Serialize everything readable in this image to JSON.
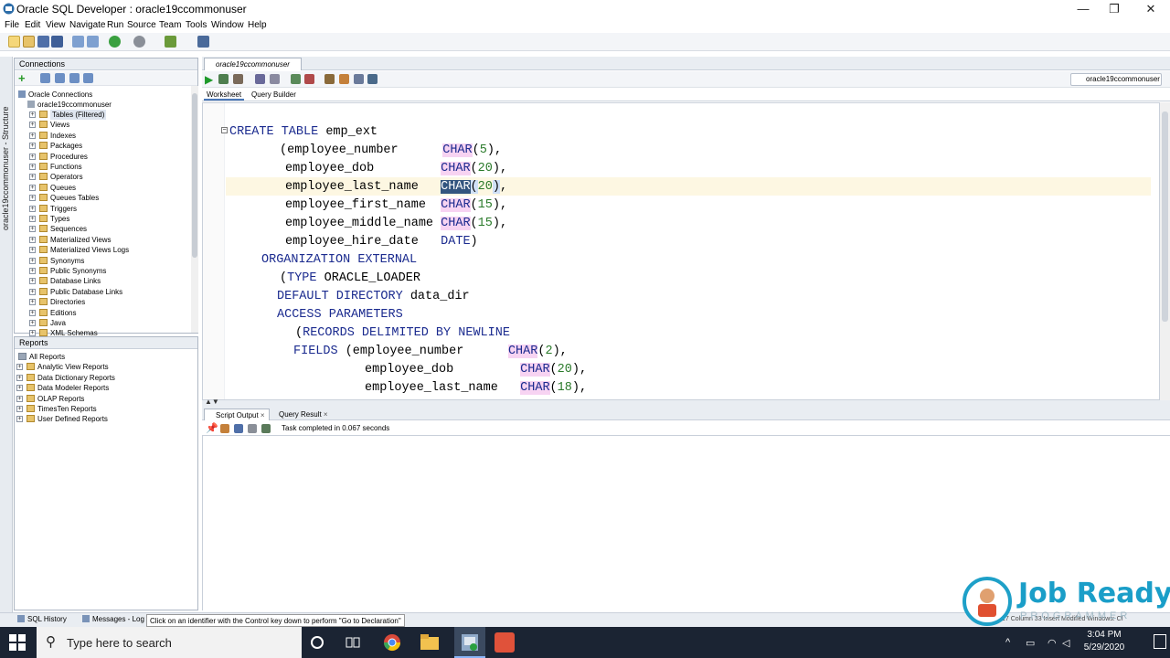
{
  "window": {
    "title": "Oracle SQL Developer : oracle19ccommonuser",
    "minimize": "—",
    "maximize": "❐",
    "close": "✕"
  },
  "menu": [
    "File",
    "Edit",
    "View",
    "Navigate",
    "Run",
    "Source",
    "Team",
    "Tools",
    "Window",
    "Help"
  ],
  "left_strip_label": "oracle19ccommonuser - Structure",
  "connections": {
    "title": "Connections",
    "root": "Oracle Connections",
    "connection": "oracle19ccommonuser",
    "items": [
      "Tables (Filtered)",
      "Views",
      "Indexes",
      "Packages",
      "Procedures",
      "Functions",
      "Operators",
      "Queues",
      "Queues Tables",
      "Triggers",
      "Types",
      "Sequences",
      "Materialized Views",
      "Materialized Views Logs",
      "Synonyms",
      "Public Synonyms",
      "Database Links",
      "Public Database Links",
      "Directories",
      "Editions",
      "Java",
      "XML Schemas"
    ]
  },
  "reports": {
    "title": "Reports",
    "items": [
      "All Reports",
      "Analytic View Reports",
      "Data Dictionary Reports",
      "Data Modeler Reports",
      "OLAP Reports",
      "TimesTen Reports",
      "User Defined Reports"
    ]
  },
  "editor": {
    "tab_label": "oracle19ccommonuser",
    "connection_select": "oracle19ccommonuser",
    "subtabs": [
      "Worksheet",
      "Query Builder"
    ]
  },
  "code": {
    "l1_kw": "CREATE TABLE",
    "l1_rest": " emp_ext",
    "l2_pre": "(employee_number      ",
    "l2_kw": "CHAR",
    "l2_p1": "(",
    "l2_num": "5",
    "l2_end": "),",
    "l3_pre": "employee_dob         ",
    "l3_kw": "CHAR",
    "l3_p1": "(",
    "l3_num": "20",
    "l3_end": "),",
    "l4_pre": "employee_last_name   ",
    "l4_kw": "CHAR",
    "l4_p1": "(",
    "l4_num": "20",
    "l4_close": ")",
    "l4_end": ",",
    "l5_pre": "employee_first_name  ",
    "l5_kw": "CHAR",
    "l5_p1": "(",
    "l5_num": "15",
    "l5_end": "),",
    "l6_pre": "employee_middle_name ",
    "l6_kw": "CHAR",
    "l6_p1": "(",
    "l6_num": "15",
    "l6_end": "),",
    "l7_pre": "employee_hire_date   ",
    "l7_kw": "DATE",
    "l7_end": ")",
    "l8_kw": "ORGANIZATION EXTERNAL",
    "l9_pre": "(",
    "l9_kw": "TYPE",
    "l9_rest": " ORACLE_LOADER",
    "l10_kw": "DEFAULT DIRECTORY",
    "l10_rest": " data_dir",
    "l11_kw": "ACCESS PARAMETERS",
    "l12_pre": "(",
    "l12_kw": "RECORDS DELIMITED BY NEWLINE",
    "l13_kw": "FIELDS",
    "l13_pre": " (employee_number      ",
    "l13_kw2": "CHAR",
    "l13_p1": "(",
    "l13_num": "2",
    "l13_end": "),",
    "l14_pre": "employee_dob         ",
    "l14_kw": "CHAR",
    "l14_p1": "(",
    "l14_num": "20",
    "l14_end": "),",
    "l15_pre": "employee_last_name   ",
    "l15_kw": "CHAR",
    "l15_p1": "(",
    "l15_num": "18",
    "l15_end": "),"
  },
  "output": {
    "tabs": [
      "Script Output",
      "Query Result"
    ],
    "tab_close": "×",
    "message": "Task completed in 0.067 seconds"
  },
  "statusbar": {
    "sql_history": "SQL History",
    "messages_log": "Messages - Log",
    "hint": "Click on an identifier with the Control key down to perform \"Go to Declaration\"",
    "right": "17 Column 33   Insert   Modified   Windows: CI"
  },
  "taskbar": {
    "search_placeholder": "Type here to search",
    "time": "3:04 PM",
    "date": "5/29/2020"
  },
  "logo": {
    "line1": "Job Ready",
    "line2": "PROGRAMMER"
  }
}
